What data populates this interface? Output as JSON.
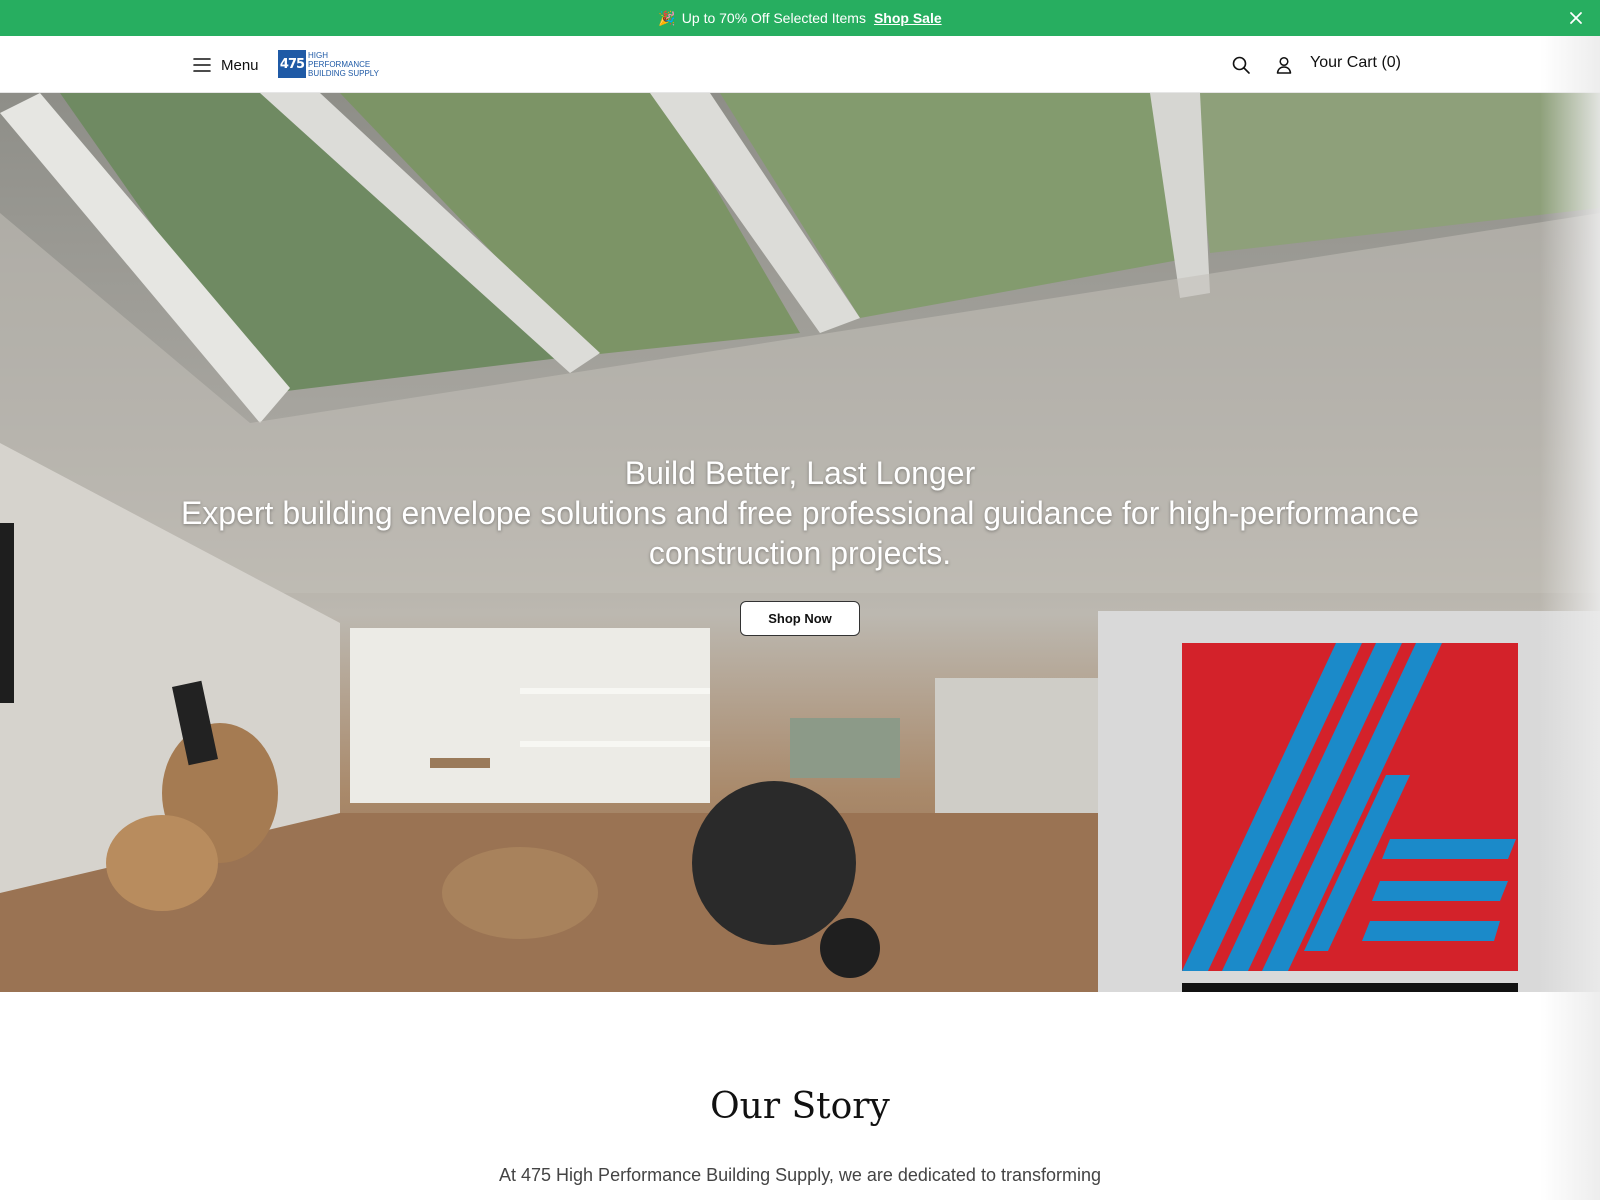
{
  "announcement": {
    "emoji": "🎉",
    "text": "Up to 70% Off Selected Items",
    "link": "Shop Sale",
    "bg_color": "#27ae60"
  },
  "header": {
    "menu_label": "Menu",
    "logo": {
      "mark": "475",
      "line1": "HIGH",
      "line2": "PERFORMANCE",
      "line3": "BUILDING SUPPLY",
      "color": "#1f5aa6"
    },
    "cart_label": "Your Cart (0)"
  },
  "hero": {
    "title": "Build Better, Last Longer",
    "subtitle": "Expert building envelope solutions and free professional guidance for high-performance construction projects.",
    "button": "Shop Now"
  },
  "brand_panel": {
    "colors": {
      "red": "#d3222a",
      "blue": "#1b8ac9"
    }
  },
  "story": {
    "title": "Our Story",
    "text": "At 475 High Performance Building Supply, we are dedicated to transforming"
  }
}
